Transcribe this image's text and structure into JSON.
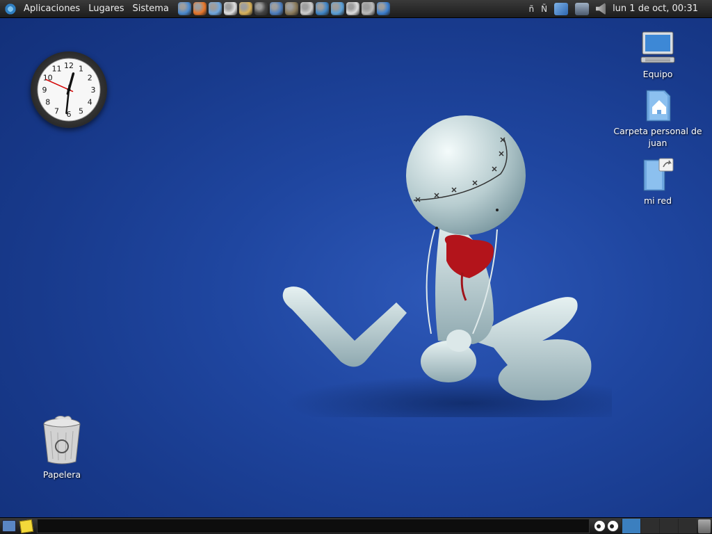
{
  "top_panel": {
    "menus": [
      "Aplicaciones",
      "Lugares",
      "Sistema"
    ],
    "launchers": [
      {
        "icon": "globe-icon",
        "color": "#4a8ad0"
      },
      {
        "icon": "firefox-icon",
        "color": "#e8762a"
      },
      {
        "icon": "mail-icon",
        "color": "#6fa8e0"
      },
      {
        "icon": "notes-icon",
        "color": "#e0e0e0"
      },
      {
        "icon": "chat-icon",
        "color": "#d9b25a"
      },
      {
        "icon": "bug-icon",
        "color": "#444444"
      },
      {
        "icon": "media-icon",
        "color": "#4d7fc0"
      },
      {
        "icon": "gimp-icon",
        "color": "#8a7a5a"
      },
      {
        "icon": "edit-icon",
        "color": "#cfcfcf"
      },
      {
        "icon": "bittorrent-icon",
        "color": "#3f86c8"
      },
      {
        "icon": "navigator-icon",
        "color": "#5aa0d8"
      },
      {
        "icon": "tools-icon",
        "color": "#dddddd"
      },
      {
        "icon": "search-icon",
        "color": "#bbbbbb"
      },
      {
        "icon": "help-icon",
        "color": "#3b7fd0"
      }
    ],
    "keyboard_layouts": [
      "ñ",
      "Ñ"
    ],
    "datetime": "lun  1 de oct, 00:31"
  },
  "desktop_icons": {
    "equipo": "Equipo",
    "home": "Carpeta personal de juan",
    "network": "mi red",
    "trash": "Papelera"
  },
  "clock_widget": {
    "numbers": [
      "12",
      "1",
      "2",
      "3",
      "4",
      "5",
      "6",
      "7",
      "8",
      "9",
      "10",
      "11"
    ],
    "hour": 0,
    "minute": 31,
    "second": 49
  },
  "bottom_panel": {
    "workspaces": 4,
    "active_workspace": 1
  },
  "colors": {
    "desktop_bg": "#1f46a0",
    "panel": "#2a2a2a",
    "second_hand": "#d40000"
  }
}
